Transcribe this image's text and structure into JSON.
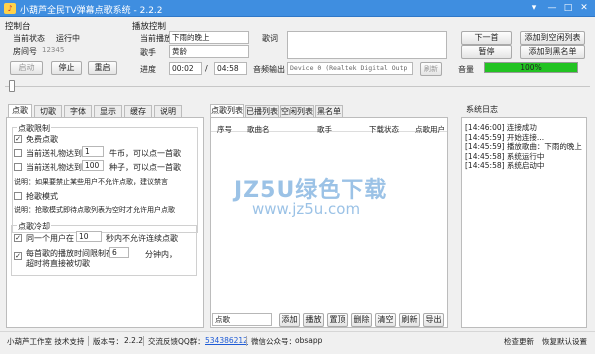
{
  "window": {
    "title": "小葫芦全民TV弹幕点歌系统 - 2.2.2",
    "buttons": {
      "settings": "▾",
      "minimize": "—",
      "maximize": "□",
      "close": "✕"
    }
  },
  "playback_panel": {
    "title": "控制台",
    "status_label": "当前状态",
    "status_value": "运行中",
    "room_label": "房间号",
    "room_value": "12345",
    "start_button": "启动",
    "stop_button": "停止",
    "restart_button": "重启"
  },
  "play_control": {
    "title": "播放控制",
    "now_playing_label": "当前播放",
    "now_playing_value": "下雨的晚上",
    "singer_label": "歌手",
    "singer_value": "黄龄",
    "lyrics_label": "歌词",
    "progress_label": "进度",
    "progress_current": "00:02",
    "progress_separator": "/",
    "progress_total": "04:58",
    "audio_output_label": "音频输出",
    "audio_output_value": "Device 0 (Realtek Digital Outp",
    "refresh_button": "刷新",
    "volume_label": "音量",
    "volume_value": "100%",
    "volume_percent": 100,
    "playback_progress": 0.007
  },
  "actions": {
    "next_button": "下一首",
    "add_free_button": "添加到空闲列表",
    "pause_button": "暂停",
    "add_blacklist_button": "添加到黑名单"
  },
  "settings_tabs": [
    "点歌",
    "切歌",
    "字体",
    "显示",
    "缓存",
    "说明"
  ],
  "song_settings": {
    "limit_group_title": "点歌限制",
    "free_song_label": "免费点歌",
    "free_song_checked": true,
    "coin_gift_prefix": "当前送礼物达到",
    "coin_gift_value": "1",
    "coin_gift_suffix": "牛币，可以点一首歌",
    "seed_gift_prefix": "当前送礼物达到",
    "seed_gift_value": "100",
    "seed_gift_suffix": "种子，可以点一首歌",
    "note1": "说明：如果要禁止某些用户不允许点歌，建议禁言",
    "grab_mode_label": "抢歌模式",
    "note2": "说明：抢歌模式即待点歌列表为空时才允许用户点歌",
    "cooldown_group_title": "点歌冷却",
    "same_user_prefix": "同一个用户在",
    "same_user_value": "10",
    "same_user_suffix": "秒内不允许连续点歌",
    "song_limit_line1": "每首歌的播放时间限制在",
    "song_limit_line2": "超时将直接被切歌",
    "song_limit_value": "6",
    "song_limit_suffix": "分钟内，"
  },
  "list_tabs": [
    "点歌列表",
    "已播列表",
    "空闲列表",
    "黑名单"
  ],
  "song_table": {
    "columns": [
      "序号",
      "歌曲名",
      "歌手",
      "下载状态",
      "点歌用户"
    ],
    "rows": []
  },
  "list_input": {
    "value": "点歌"
  },
  "list_buttons": [
    "添加",
    "播放",
    "置顶",
    "删除",
    "清空",
    "刷新",
    "导出"
  ],
  "system_log": {
    "title": "系统日志",
    "entries": [
      "[14:46:00] 连接成功",
      "[14:45:59] 开始连接...",
      "[14:45:59] 播放歌曲：下雨的晚上",
      "[14:45:58] 系统运行中",
      "[14:45:58] 系统启动中"
    ]
  },
  "watermark": {
    "line1": "JZ5U绿色下载",
    "line2": "www.jz5u.com"
  },
  "status_bar": {
    "studio": "小葫芦工作室 技术支持",
    "version_label": "版本号：",
    "version_value": "2.2.2",
    "qq_label": "交流反馈QQ群：",
    "qq_value": "534386212",
    "wechat_label": "微信公众号：",
    "wechat_value": "obsapp",
    "check_update": "检查更新",
    "restore_default": "恢复默认设置"
  },
  "colors": {
    "titlebar": "#3f8ee0",
    "volume_bar": "#22c322",
    "link": "#1e5bd6",
    "watermark": "#9bc2e6"
  }
}
